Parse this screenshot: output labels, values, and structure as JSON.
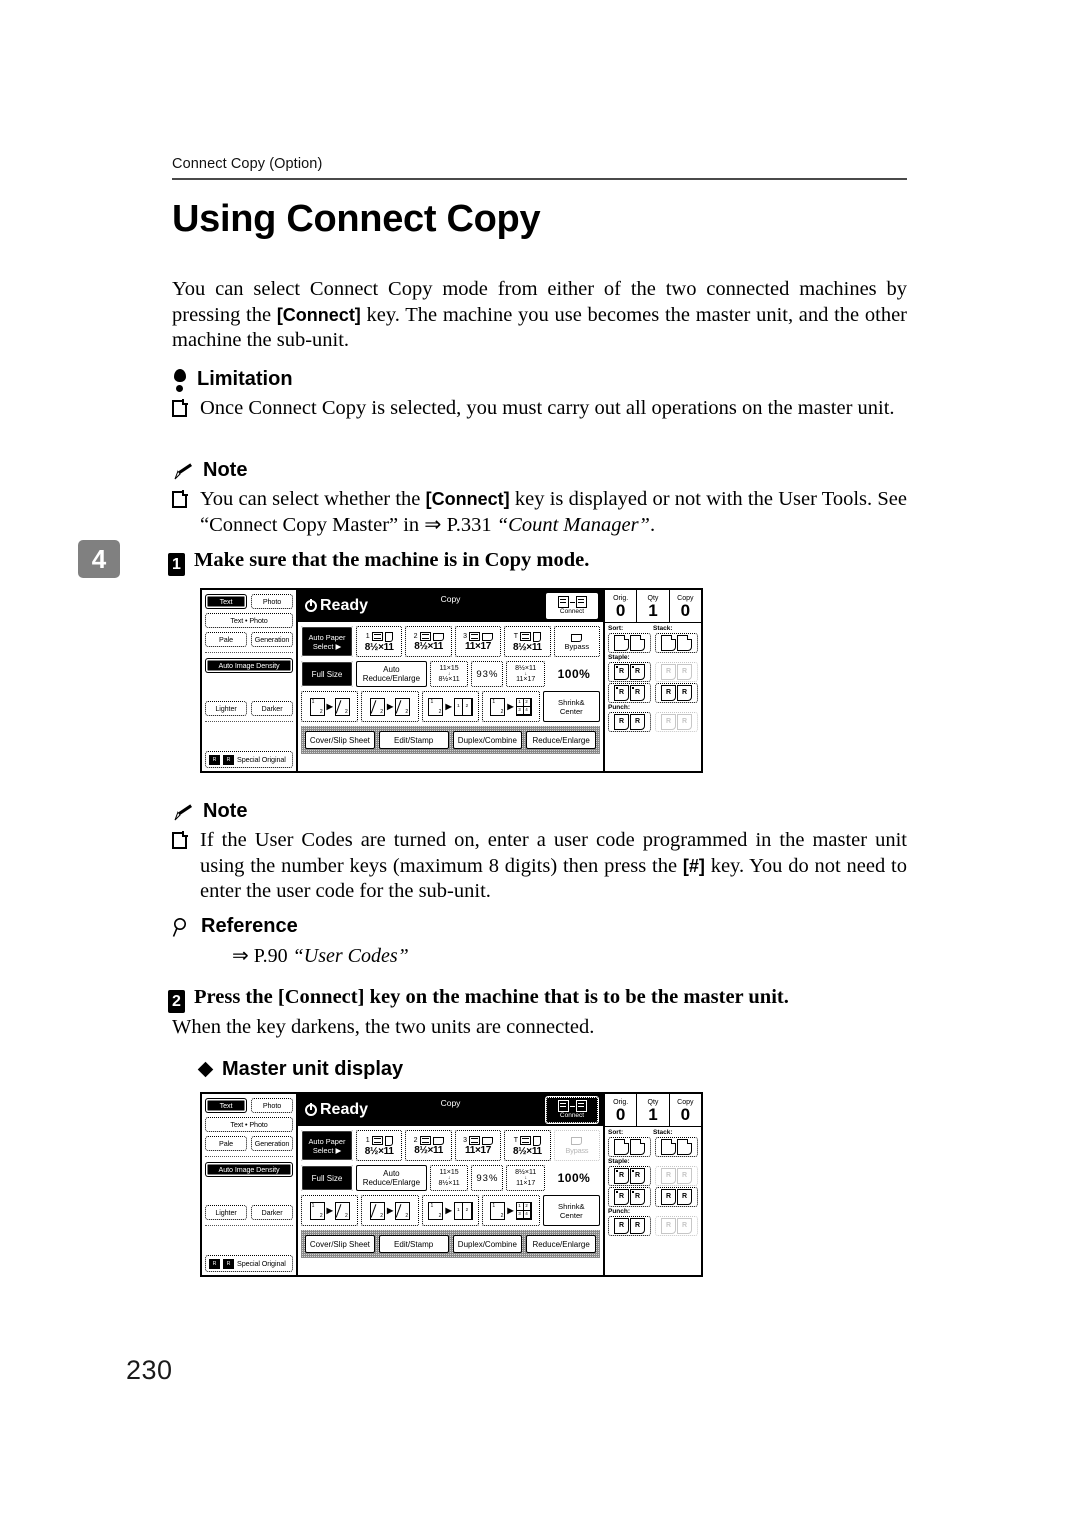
{
  "page": {
    "running_head": "Connect Copy (Option)",
    "chapter_tab": "4",
    "page_number": "230",
    "title": "Using Connect Copy"
  },
  "intro": {
    "text_part1": "You can select Connect Copy mode from either of the two connected machines by pressing the ",
    "key": "[Connect]",
    "text_part2": " key. The machine you use becomes the master unit, and the other machine the sub-unit."
  },
  "limitation": {
    "heading": "Limitation",
    "item": "Once Connect Copy is selected, you must carry out all operations on the master unit."
  },
  "note1": {
    "heading": "Note",
    "item_part1": "You can select whether the ",
    "key": "[Connect]",
    "item_part2": " key is displayed or not with the User Tools. See “Connect Copy Master” in ⇒ P.331 ",
    "italic": "“Count Manager”",
    "item_part3": "."
  },
  "step1": {
    "num": "1",
    "text": "Make sure that the machine is in Copy mode."
  },
  "note2": {
    "heading": "Note",
    "item_part1": "If the User Codes are turned on, enter a user code programmed in the master unit using the number keys (maximum 8 digits) then press the ",
    "key": "[#]",
    "item_part2": " key. You do not need to enter the user code for the sub-unit."
  },
  "reference": {
    "heading": "Reference",
    "line_arrow": "⇒ P.90 ",
    "line_italic": "“User Codes”"
  },
  "step2": {
    "num": "2",
    "text_part1": "Press the ",
    "key": "[Connect]",
    "text_part2": " key on the machine that is to be the master unit.",
    "followup": "When the key darkens, the two units are connected."
  },
  "master_display_head": "Master unit display",
  "lcd": {
    "status": "Ready",
    "mode": "Copy",
    "connect_label": "Connect",
    "left_buttons": {
      "text": "Text",
      "photo": "Photo",
      "text_photo": "Text • Photo",
      "pale": "Pale",
      "generation": "Generation",
      "auto_image_density": "Auto Image Density",
      "lighter": "Lighter",
      "darker": "Darker",
      "special_original": "Special Original"
    },
    "paper": {
      "auto_select_line1": "Auto Paper",
      "auto_select_line2": "Select",
      "trays": [
        {
          "num": "1",
          "size": "8½×11",
          "orient": "portrait"
        },
        {
          "num": "2",
          "size": "8½×11",
          "orient": "landscape"
        },
        {
          "num": "3",
          "size": "11×17",
          "orient": "landscape"
        },
        {
          "num": "T",
          "size": "8½×11",
          "orient": "portrait"
        }
      ],
      "bypass": "Bypass"
    },
    "reduce_enlarge": {
      "full_size": "Full Size",
      "auto": "Auto Reduce/Enlarge",
      "ratio1_top": "11×15",
      "ratio1_bottom": "8½×11",
      "ratio2": "93%",
      "ratio3_top": "8½×11",
      "ratio3_bottom": "11×17",
      "current": "100%"
    },
    "duplex_row": {
      "shrink_center_line1": "Shrink&",
      "shrink_center_line2": "Center"
    },
    "func_tabs": [
      "Cover/Slip Sheet",
      "Edit/Stamp",
      "Duplex/Combine",
      "Reduce/Enlarge"
    ],
    "counters": [
      {
        "label": "Orig.",
        "value": "0"
      },
      {
        "label": "Qty",
        "value": "1"
      },
      {
        "label": "Copy",
        "value": "0"
      }
    ],
    "finisher": {
      "sort": "Sort:",
      "stack": "Stack:",
      "staple": "Staple:",
      "punch": "Punch:"
    }
  },
  "colors": {
    "chapter_tab_bg": "#808080",
    "lcd_bar_bg": "#000000",
    "func_bar_bg": "#d6d6d6",
    "ghost": "#c7c7c7"
  }
}
